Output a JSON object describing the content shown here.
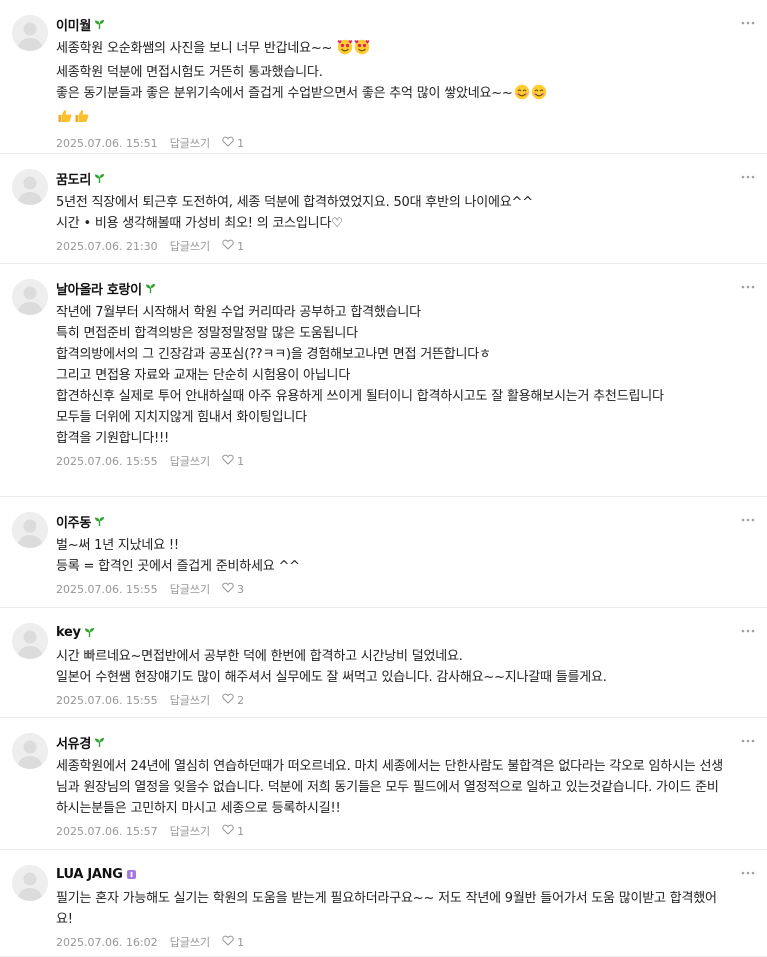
{
  "comments": [
    {
      "author": "이미월",
      "badge": "sprout-badge-icon",
      "lines": [
        {
          "text": "세종학원 오순화쌤의 사진을 보니 너무 반갑네요~~ ",
          "emoji": [
            "smiling-face-with-hearts-icon",
            "smiling-face-with-hearts-icon"
          ]
        },
        {
          "text": "세종학원 덕분에 면접시험도 거뜬히 통과했습니다.",
          "emoji": []
        },
        {
          "text": "좋은 동기분들과 좋은 분위기속에서 즐겁게 수업받으면서 좋은 추억 많이 쌓았네요~~",
          "emoji": [
            "smiling-face-icon",
            "smiling-face-icon"
          ]
        },
        {
          "text": "",
          "emoji": [
            "thumbs-up-icon",
            "thumbs-up-icon"
          ]
        }
      ],
      "date": "2025.07.06. 15:51",
      "reply_label": "답글쓰기",
      "likes": "1"
    },
    {
      "author": "꿈도리",
      "badge": "sprout-badge-icon",
      "lines": [
        {
          "text": "5년전 직장에서 퇴근후 도전하여, 세종 덕분에 합격하였었지요. 50대 후반의 나이에요^^",
          "emoji": []
        },
        {
          "text": "시간 • 비용 생각해볼때 가성비 최오! 의 코스입니다♡",
          "emoji": []
        }
      ],
      "date": "2025.07.06. 21:30",
      "reply_label": "답글쓰기",
      "likes": "1"
    },
    {
      "author": "날아올라 호랑이",
      "badge": "sprout-badge-icon",
      "lines": [
        {
          "text": "작년에 7월부터 시작해서 학원 수업 커리따라 공부하고 합격했습니다",
          "emoji": []
        },
        {
          "text": "특히 면접준비 합격의방은 정말정말정말 많은 도움됩니다",
          "emoji": []
        },
        {
          "text": "합격의방에서의 그 긴장감과 공포심(??ㅋㅋ)을 경험해보고나면 면접 거뜬합니다ㅎ",
          "emoji": []
        },
        {
          "text": "그리고 면접용 자료와 교재는 단순히 시험용이 아닙니다",
          "emoji": []
        },
        {
          "text": "합견하신후 실제로 투어 안내하실때 아주 유용하게 쓰이게 될터이니 합격하시고도 잘 활용해보시는거 추천드립니다",
          "emoji": [],
          "wrap": true
        },
        {
          "text": "모두들 더위에 지치지않게 힘내서 화이팅입니다",
          "emoji": []
        },
        {
          "text": "합격을 기원합니다!!!",
          "emoji": []
        }
      ],
      "date": "2025.07.06. 15:55",
      "reply_label": "답글쓰기",
      "likes": "1"
    },
    {
      "author": "이주동",
      "badge": "sprout-badge-icon",
      "lines": [
        {
          "text": "벌~써 1년 지났네요 !!",
          "emoji": []
        },
        {
          "text": "등록 = 합격인 곳에서 즐겁게 준비하세요 ^^",
          "emoji": []
        }
      ],
      "date": "2025.07.06. 15:55",
      "reply_label": "답글쓰기",
      "likes": "3"
    },
    {
      "author": "key",
      "badge": "sprout-badge-icon",
      "lines": [
        {
          "text": "시간 빠르네요~면접반에서 공부한 덕에 한번에 합격하고 시간낭비 덜었네요.",
          "emoji": []
        },
        {
          "text": "일본어 수현쌤 현장얘기도 많이 해주셔서 실무에도 잘 써먹고 있습니다. 감사해요~~지나갈때 들를게요.",
          "emoji": []
        }
      ],
      "date": "2025.07.06. 15:55",
      "reply_label": "답글쓰기",
      "likes": "2"
    },
    {
      "author": "서유경",
      "badge": "sprout-badge-icon",
      "lines": [
        {
          "text": "세종학원에서 24년에 열심히 연습하던때가 떠오르네요. 마치 세종에서는 단한사람도 불합격은 없다라는 각오로 임하시는 선생님과 원장님의 열정을 잊을수 없습니다. 덕분에 저희 동기들은 모두 필드에서 열정적으로 일하고 있는것같습니다. 가이드 준비하시는분들은 고민하지 마시고 세종으로 등록하시길!!",
          "emoji": [],
          "wrap": true
        }
      ],
      "date": "2025.07.06. 15:57",
      "reply_label": "답글쓰기",
      "likes": "1"
    },
    {
      "author": "LUA JANG",
      "badge": "purple-level-badge-icon",
      "lines": [
        {
          "text": "필기는 혼자 가능해도 실기는 학원의 도움을 받는게 필요하더라구요~~ 저도 작년에 9월반 들어가서 도움 많이받고 합격했어요!",
          "emoji": [],
          "wrap": true
        }
      ],
      "date": "2025.07.06. 16:02",
      "reply_label": "답글쓰기",
      "likes": "1"
    }
  ],
  "icons": {
    "more": "more-vertical-icon",
    "like": "heart-outline-icon",
    "avatar": "default-avatar-icon"
  },
  "colors": {
    "sprout": "#33a532",
    "purple_badge": "#a47ae2",
    "meta": "#979797"
  }
}
